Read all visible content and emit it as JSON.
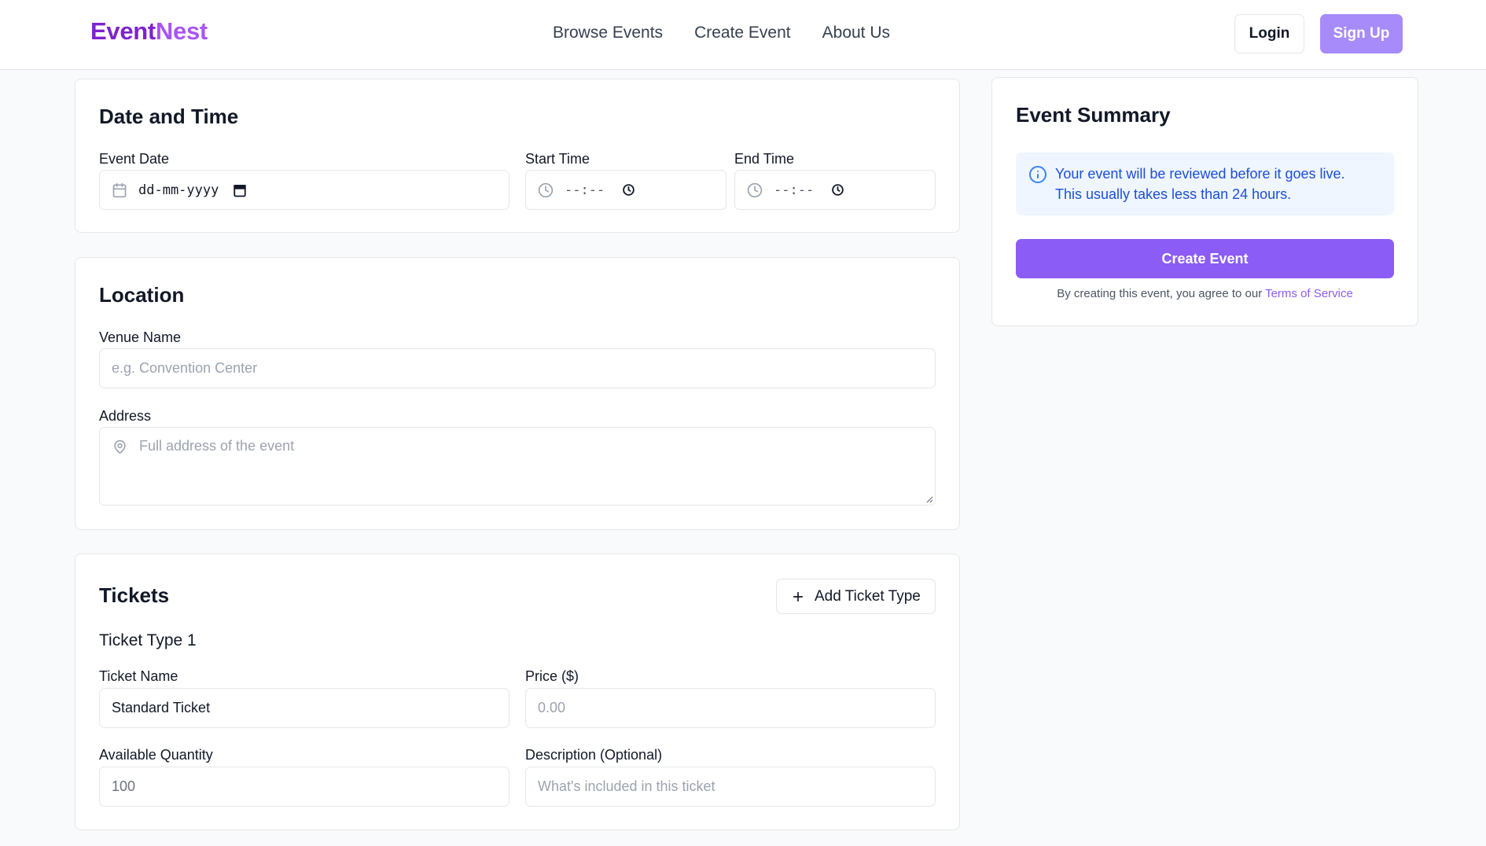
{
  "header": {
    "logo_part1": "Event",
    "logo_part2": "Nest",
    "nav": [
      "Browse Events",
      "Create Event",
      "About Us"
    ],
    "login_label": "Login",
    "signup_label": "Sign Up"
  },
  "date_time": {
    "title": "Date and Time",
    "event_date_label": "Event Date",
    "event_date_value": "dd-mm-yyyy",
    "start_time_label": "Start Time",
    "start_time_value": "--:--",
    "end_time_label": "End Time",
    "end_time_value": "--:--"
  },
  "location": {
    "title": "Location",
    "venue_label": "Venue Name",
    "venue_placeholder": "e.g. Convention Center",
    "address_label": "Address",
    "address_placeholder": "Full address of the event"
  },
  "tickets": {
    "title": "Tickets",
    "add_button_label": "Add Ticket Type",
    "ticket_type_heading": "Ticket Type 1",
    "name_label": "Ticket Name",
    "name_value": "Standard Ticket",
    "price_label": "Price ($)",
    "price_placeholder": "0.00",
    "quantity_label": "Available Quantity",
    "quantity_value": "100",
    "description_label": "Description (Optional)",
    "description_placeholder": "What's included in this ticket"
  },
  "summary": {
    "title": "Event Summary",
    "info_line1": "Your event will be reviewed before it goes live.",
    "info_line2": "This usually takes less than 24 hours.",
    "create_button_label": "Create Event",
    "terms_text": "By creating this event, you agree to our",
    "terms_link": "Terms of Service"
  },
  "colors": {
    "brand": "#7e22ce",
    "accent": "#8b5cf6",
    "signup": "#a78bfa",
    "info_bg": "#eff6ff",
    "info_text": "#1d4ed8"
  }
}
